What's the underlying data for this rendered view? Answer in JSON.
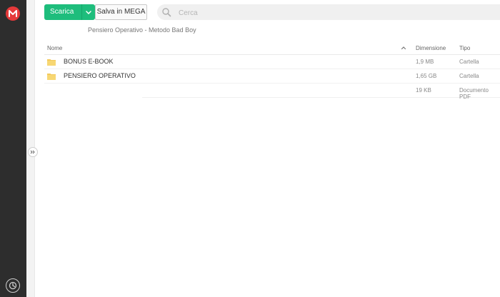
{
  "toolbar": {
    "download_label": "Scarica",
    "save_label": "Salva in MEGA"
  },
  "search": {
    "placeholder": "Cerca",
    "value": ""
  },
  "folder": {
    "title": "Pensiero Operativo - Metodo Bad Boy"
  },
  "table": {
    "headers": {
      "name": "Nome",
      "size": "Dimensione",
      "type": "Tipo"
    },
    "rows": [
      {
        "name": "BONUS E-BOOK",
        "size": "1,9 MB",
        "type": "Cartella",
        "icon": "folder-icon"
      },
      {
        "name": "PENSIERO OPERATIVO",
        "size": "1,65 GB",
        "type": "Cartella",
        "icon": "folder-icon"
      },
      {
        "name": "",
        "size": "19 KB",
        "type": "Documento PDF",
        "icon": ""
      }
    ]
  },
  "colors": {
    "sidebar": "#2d2d2d",
    "logo": "#e5393a",
    "download_button": "#1ebd7c",
    "folder": "#f3c95b"
  }
}
